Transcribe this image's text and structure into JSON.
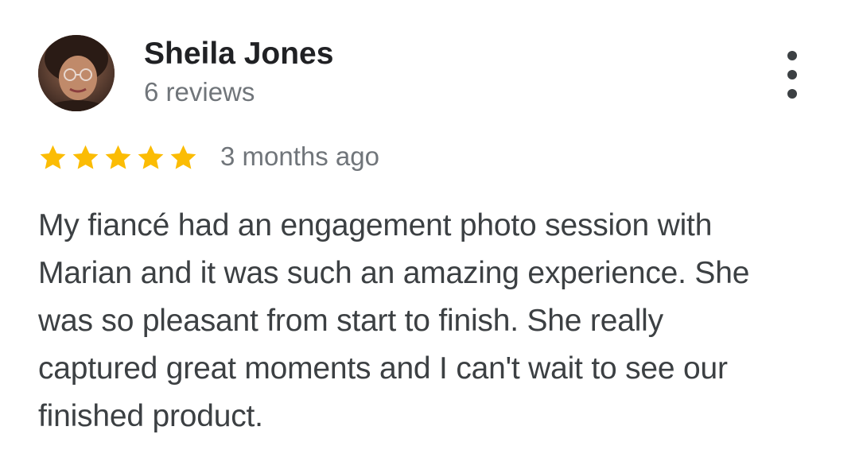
{
  "review": {
    "reviewer_name": "Sheila Jones",
    "review_count": "6 reviews",
    "rating": 5,
    "rating_max": 5,
    "time_ago": "3 months ago",
    "text_lines": [
      "My fiancé had an engagement photo session with",
      "Marian and it was such an amazing experience. She",
      "was so pleasant from start to finish. She really",
      "captured great moments and I can't wait to see our",
      "finished product."
    ]
  },
  "icons": {
    "more": "more-vert-icon",
    "star": "star-icon",
    "avatar": "avatar"
  },
  "colors": {
    "star": "#fbbc04",
    "name": "#202124",
    "secondary": "#70757a",
    "body_text": "#3c4043"
  }
}
